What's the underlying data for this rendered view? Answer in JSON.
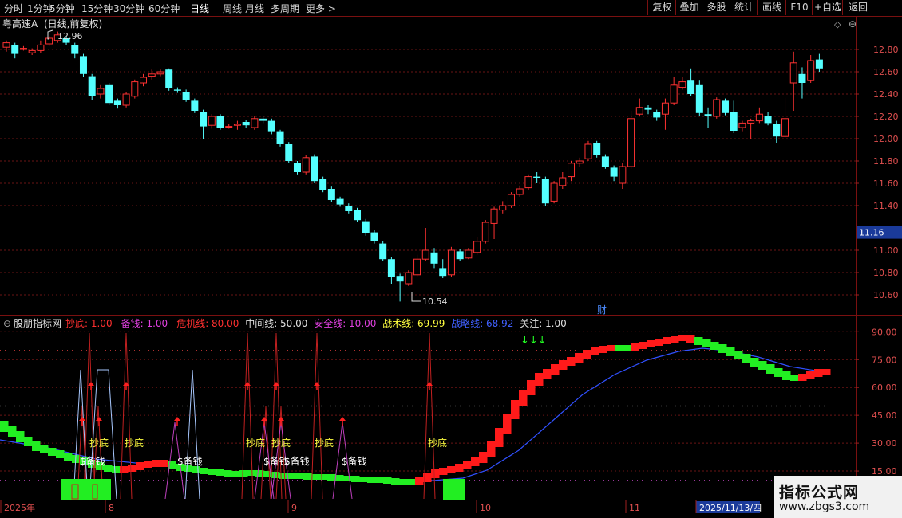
{
  "toolbar": {
    "periods": [
      "分时",
      "1分钟",
      "5分钟",
      "15分钟",
      "30分钟",
      "60分钟",
      "日线",
      "周线",
      "月线",
      "多周期",
      "更多"
    ],
    "active_period": "日线",
    "more_arrow": ">",
    "right_buttons": [
      "复权",
      "叠加",
      "多股",
      "统计",
      "画线",
      "F10",
      "+自选",
      "返回"
    ]
  },
  "main": {
    "title": "粤高速A",
    "title_suffix": "(日线,前复权)",
    "max_label": "12.96",
    "min_label": "10.54",
    "current_price": "11.16",
    "fin_marker": "财",
    "price_ticks": [
      "12.80",
      "12.60",
      "12.40",
      "12.20",
      "12.00",
      "11.80",
      "11.60",
      "11.40",
      "11.00",
      "10.80",
      "10.60"
    ]
  },
  "indicator": {
    "name": "股朋指标网",
    "params": [
      {
        "label": "抄底:",
        "value": "1.00",
        "color": "#ff3030"
      },
      {
        "label": "备钱:",
        "value": "1.00",
        "color": "#e040e0"
      },
      {
        "label": "危机线:",
        "value": "80.00",
        "color": "#ff3030"
      },
      {
        "label": "中间线:",
        "value": "50.00",
        "color": "#e0e0e0"
      },
      {
        "label": "安全线:",
        "value": "10.00",
        "color": "#e040e0"
      },
      {
        "label": "战术线:",
        "value": "69.99",
        "color": "#ffff40"
      },
      {
        "label": "战略线:",
        "value": "68.92",
        "color": "#4060ff"
      },
      {
        "label": "关注:",
        "value": "1.00",
        "color": "#e0e0e0"
      }
    ],
    "ticks": [
      "90.00",
      "75.00",
      "60.00",
      "45.00",
      "30.00",
      "15.00"
    ],
    "chaodi_text": "抄底",
    "beiqian_text": "$备钱",
    "arrows_text": "↓↓↓"
  },
  "timeline": {
    "labels": [
      "2025年",
      "8",
      "9",
      "10",
      "11",
      "2025/11/13/四"
    ]
  },
  "watermark": {
    "line1": "指标公式网",
    "line2": "www.zbgs3.com"
  },
  "colors": {
    "up": "#ff3232",
    "down": "#54ffff",
    "grid": "#7a1010",
    "tactical_up": "#ff1a1a",
    "tactical_down": "#22ee22",
    "strategic": "#3050ff"
  },
  "chart_data": {
    "type": "candlestick",
    "candles": [
      [
        12.82,
        12.86,
        12.88,
        12.78
      ],
      [
        12.84,
        12.76,
        12.86,
        12.72
      ],
      [
        12.8,
        12.81,
        12.83,
        12.79
      ],
      [
        12.77,
        12.79,
        12.81,
        12.75
      ],
      [
        12.79,
        12.84,
        12.88,
        12.77
      ],
      [
        12.85,
        12.9,
        12.92,
        12.83
      ],
      [
        12.88,
        12.93,
        12.96,
        12.86
      ],
      [
        12.9,
        12.86,
        12.92,
        12.84
      ],
      [
        12.84,
        12.76,
        12.86,
        12.72
      ],
      [
        12.74,
        12.58,
        12.76,
        12.55
      ],
      [
        12.56,
        12.38,
        12.58,
        12.35
      ],
      [
        12.4,
        12.45,
        12.48,
        12.36
      ],
      [
        12.48,
        12.32,
        12.5,
        12.3
      ],
      [
        12.34,
        12.3,
        12.36,
        12.27
      ],
      [
        12.3,
        12.4,
        12.42,
        12.28
      ],
      [
        12.38,
        12.51,
        12.53,
        12.36
      ],
      [
        12.5,
        12.55,
        12.58,
        12.47
      ],
      [
        12.56,
        12.58,
        12.62,
        12.53
      ],
      [
        12.58,
        12.6,
        12.62,
        12.56
      ],
      [
        12.62,
        12.45,
        12.63,
        12.43
      ],
      [
        12.44,
        12.43,
        12.46,
        12.41
      ],
      [
        12.42,
        12.35,
        12.44,
        12.33
      ],
      [
        12.34,
        12.25,
        12.36,
        12.23
      ],
      [
        12.24,
        12.11,
        12.26,
        12.0
      ],
      [
        12.12,
        12.2,
        12.22,
        12.09
      ],
      [
        12.2,
        12.1,
        12.22,
        12.08
      ],
      [
        12.11,
        12.11,
        12.13,
        12.09
      ],
      [
        12.12,
        12.13,
        12.16,
        12.08
      ],
      [
        12.15,
        12.12,
        12.17,
        12.1
      ],
      [
        12.1,
        12.18,
        12.2,
        12.08
      ],
      [
        12.18,
        12.16,
        12.2,
        12.14
      ],
      [
        12.16,
        12.06,
        12.18,
        12.04
      ],
      [
        12.06,
        11.95,
        12.08,
        11.93
      ],
      [
        11.95,
        11.8,
        11.97,
        11.78
      ],
      [
        11.78,
        11.7,
        11.8,
        11.68
      ],
      [
        11.7,
        11.83,
        11.85,
        11.68
      ],
      [
        11.84,
        11.62,
        11.86,
        11.6
      ],
      [
        11.64,
        11.54,
        11.66,
        11.52
      ],
      [
        11.55,
        11.45,
        11.57,
        11.43
      ],
      [
        11.46,
        11.41,
        11.48,
        11.39
      ],
      [
        11.4,
        11.35,
        11.42,
        11.33
      ],
      [
        11.36,
        11.27,
        11.38,
        11.25
      ],
      [
        11.26,
        11.15,
        11.28,
        11.13
      ],
      [
        11.16,
        11.08,
        11.18,
        11.06
      ],
      [
        11.06,
        10.92,
        11.08,
        10.9
      ],
      [
        10.92,
        10.76,
        10.94,
        10.7
      ],
      [
        10.77,
        10.72,
        10.79,
        10.54
      ],
      [
        10.7,
        10.8,
        10.82,
        10.68
      ],
      [
        10.78,
        10.92,
        10.96,
        10.76
      ],
      [
        10.92,
        11.0,
        11.2,
        10.9
      ],
      [
        10.98,
        10.88,
        11.02,
        10.84
      ],
      [
        10.84,
        10.77,
        10.92,
        10.75
      ],
      [
        10.78,
        11.0,
        11.03,
        10.76
      ],
      [
        10.99,
        10.92,
        11.01,
        10.9
      ],
      [
        10.93,
        11.0,
        11.02,
        10.92
      ],
      [
        10.98,
        11.08,
        11.12,
        10.96
      ],
      [
        11.08,
        11.25,
        11.27,
        11.06
      ],
      [
        11.24,
        11.37,
        11.39,
        11.1
      ],
      [
        11.36,
        11.4,
        11.44,
        11.33
      ],
      [
        11.4,
        11.5,
        11.52,
        11.38
      ],
      [
        11.5,
        11.55,
        11.58,
        11.48
      ],
      [
        11.56,
        11.66,
        11.68,
        11.54
      ],
      [
        11.66,
        11.65,
        11.7,
        11.6
      ],
      [
        11.64,
        11.42,
        11.66,
        11.4
      ],
      [
        11.44,
        11.6,
        11.62,
        11.42
      ],
      [
        11.58,
        11.65,
        11.7,
        11.55
      ],
      [
        11.66,
        11.78,
        11.8,
        11.62
      ],
      [
        11.78,
        11.8,
        11.83,
        11.75
      ],
      [
        11.82,
        11.95,
        11.98,
        11.8
      ],
      [
        11.96,
        11.85,
        11.98,
        11.83
      ],
      [
        11.84,
        11.75,
        11.86,
        11.73
      ],
      [
        11.74,
        11.66,
        11.76,
        11.62
      ],
      [
        11.6,
        11.75,
        11.78,
        11.55
      ],
      [
        11.75,
        12.18,
        12.25,
        11.73
      ],
      [
        12.22,
        12.28,
        12.36,
        12.2
      ],
      [
        12.28,
        12.26,
        12.3,
        12.22
      ],
      [
        12.24,
        12.19,
        12.26,
        12.16
      ],
      [
        12.22,
        12.32,
        12.36,
        12.08
      ],
      [
        12.32,
        12.48,
        12.55,
        12.3
      ],
      [
        12.46,
        12.51,
        12.55,
        12.44
      ],
      [
        12.52,
        12.4,
        12.63,
        12.38
      ],
      [
        12.48,
        12.23,
        12.52,
        12.2
      ],
      [
        12.22,
        12.2,
        12.28,
        12.1
      ],
      [
        12.2,
        12.35,
        12.37,
        12.18
      ],
      [
        12.34,
        12.23,
        12.36,
        12.21
      ],
      [
        12.24,
        12.07,
        12.34,
        12.05
      ],
      [
        12.1,
        12.14,
        12.16,
        12.06
      ],
      [
        12.14,
        12.16,
        12.18,
        12.0
      ],
      [
        12.16,
        12.22,
        12.28,
        12.14
      ],
      [
        12.2,
        12.14,
        12.24,
        12.12
      ],
      [
        12.13,
        12.02,
        12.16,
        11.96
      ],
      [
        12.02,
        12.18,
        12.37,
        12.0
      ],
      [
        12.5,
        12.68,
        12.78,
        12.25
      ],
      [
        12.58,
        12.5,
        12.64,
        12.36
      ],
      [
        12.52,
        12.7,
        12.75,
        12.5
      ],
      [
        12.71,
        12.63,
        12.76,
        12.6
      ]
    ]
  }
}
